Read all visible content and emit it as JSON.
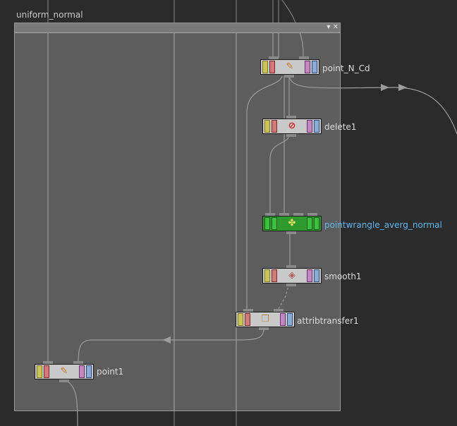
{
  "network_box": {
    "title": "uniform_normal",
    "minimize_icon": "chevron-down-icon",
    "close_icon": "close-icon",
    "minimize_glyph": "▾",
    "close_glyph": "✕"
  },
  "nodes": {
    "point_n_cd": {
      "label": "point_N_Cd",
      "icon": "point-sop-icon",
      "glyph": "✎"
    },
    "delete1": {
      "label": "delete1",
      "icon": "delete-sop-icon",
      "glyph": "⊘"
    },
    "pointwrangle": {
      "label": "pointwrangle_averg_normal",
      "icon": "wrangle-sop-icon",
      "glyph": "✤",
      "color": "#2f9b2f"
    },
    "smooth1": {
      "label": "smooth1",
      "icon": "smooth-sop-icon",
      "glyph": "◈"
    },
    "attribtransfer1": {
      "label": "attribtransfer1",
      "icon": "attribtransfer-sop-icon",
      "glyph": "❒"
    },
    "point1": {
      "label": "point1",
      "icon": "point-sop-icon",
      "glyph": "✎"
    }
  },
  "colors": {
    "background": "#2b2b2b",
    "network_box": "#5d5d5d",
    "selected_label": "#5db6f0",
    "wire": "#9c9c9c"
  }
}
